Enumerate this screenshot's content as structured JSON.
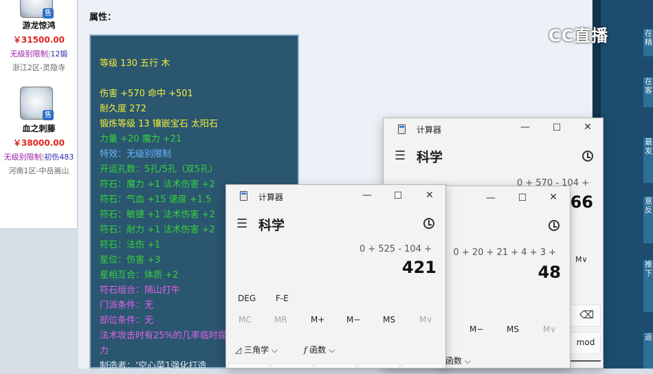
{
  "items": [
    {
      "name": "游龙惊鸿",
      "price": "￥31500.00",
      "restriction": "无级别限制",
      "extra": "12锻",
      "server": "浙江2区-灵隐寺",
      "badge": "售"
    },
    {
      "name": "血之刺藤",
      "price": "￥38000.00",
      "restriction": "无级别限制",
      "extra": "初伤483",
      "server": "河南1区-中岳嵩山",
      "badge": "售"
    }
  ],
  "attr": {
    "title": "属性：",
    "lines": [
      {
        "text": "等级 130 五行 木",
        "color": "yellow"
      },
      {
        "text": "伤害 +570 命中 +501",
        "color": "yellow"
      },
      {
        "text": "耐久度 272",
        "color": "yellow"
      },
      {
        "text": "锻炼等级 13 镶嵌宝石 太阳石",
        "color": "yellow"
      },
      {
        "text": "力量 +20 魔力 +21",
        "color": "green"
      },
      {
        "text": "特效：无级别限制",
        "color": "blue"
      },
      {
        "text": "开运孔数：5孔/5孔（双5孔）",
        "color": "green"
      },
      {
        "text": "符石：魔力 +1 法术伤害 +2",
        "color": "green"
      },
      {
        "text": "符石：气血 +15 速度 +1.5",
        "color": "green"
      },
      {
        "text": "符石：敏捷 +1 法术伤害 +2",
        "color": "green"
      },
      {
        "text": "符石：耐力 +1 法术伤害 +2",
        "color": "green"
      },
      {
        "text": "符石：法伤 +1",
        "color": "green"
      },
      {
        "text": "星位：伤害 +3",
        "color": "green"
      },
      {
        "text": "星相互合：体质 +2",
        "color": "green"
      },
      {
        "text": "符石组合：隔山打牛",
        "color": "pink"
      },
      {
        "text": "门派条件：无",
        "color": "pink"
      },
      {
        "text": "部位条件：无",
        "color": "pink"
      },
      {
        "text": "法术攻击时有25%的几率临时提",
        "color": "pink"
      },
      {
        "text": "力",
        "color": "pink"
      },
      {
        "text": "制造者：‘空心菜1强化打造",
        "color": "white"
      }
    ]
  },
  "stream": {
    "logo": "CC直播"
  },
  "right_tabs": [
    "在\n精",
    "在\n客",
    "最\n发",
    "意\n反",
    "推\n下",
    "返"
  ],
  "calc_back": {
    "title": "计算器",
    "mode": "科学",
    "expression": "0 + 570 - 104 +",
    "result": "466",
    "keys": {
      "mminus": "M−",
      "ms": "MS",
      "mv": "M∨",
      "mod": "mod",
      "func": "函数"
    }
  },
  "calc_mid": {
    "title": "",
    "expression": "0 + 20 + 21 + 4 + 3 +",
    "result": "48"
  },
  "calc_front": {
    "title": "计算器",
    "mode": "科学",
    "expression": "0 + 525 - 104 +",
    "result": "421",
    "deg": "DEG",
    "fe": "F-E",
    "memory": [
      "MC",
      "MR",
      "M+",
      "M−",
      "MS",
      "M∨"
    ],
    "trig": "三角学",
    "func": "函数"
  }
}
